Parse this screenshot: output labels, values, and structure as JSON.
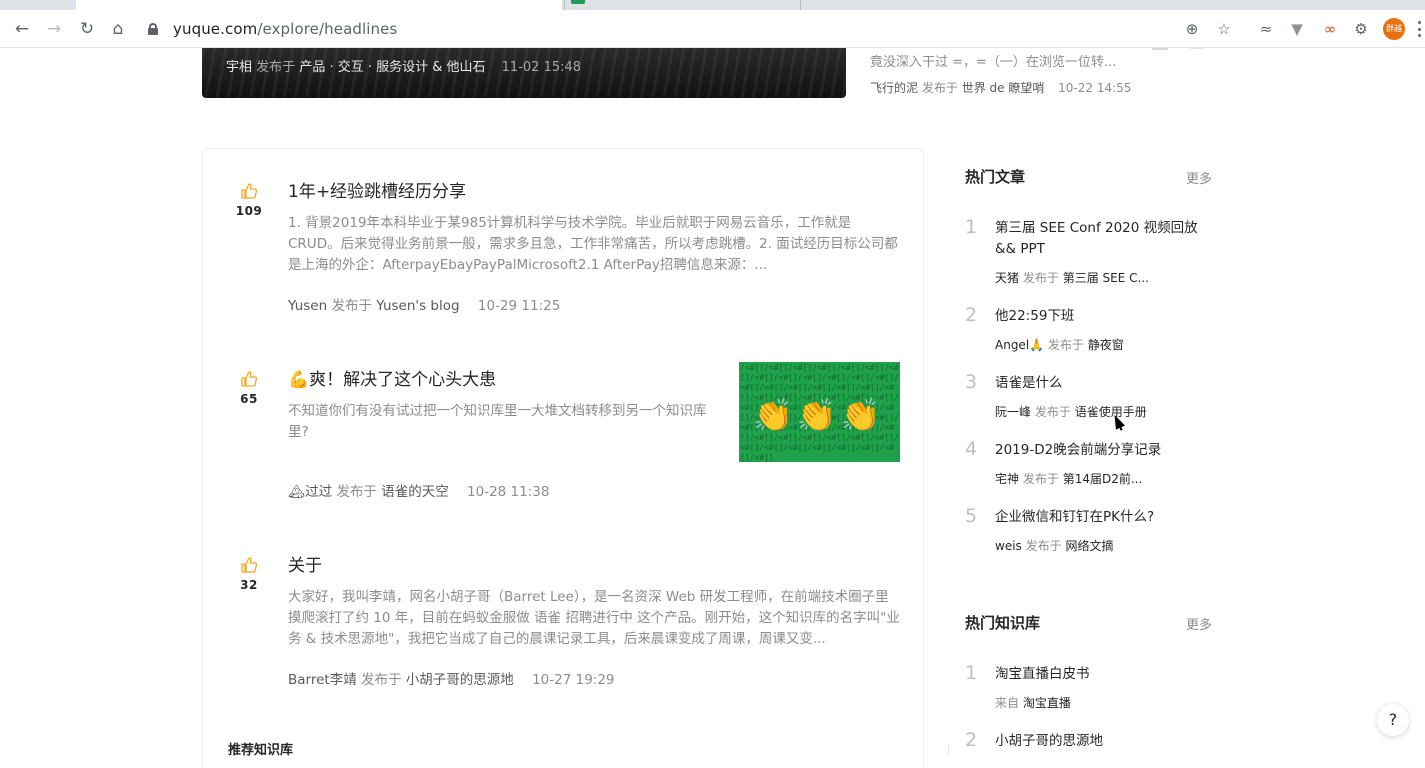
{
  "browser": {
    "url_host": "yuque.com",
    "url_path": "/explore/headlines",
    "extension_badge": "群越"
  },
  "hero": {
    "author": "宇相",
    "published_in": "发布于",
    "book": "产品 · 交互 · 服务设计 & 他山石",
    "time": "11-02 15:48"
  },
  "top_right": {
    "excerpt": "竟没深入干过 =，=（一）在浏览一位转...",
    "author": "飞行的泥",
    "published_in": "发布于",
    "book": "世界 de 瞭望哨",
    "time": "10-22 14:55"
  },
  "feed": {
    "posts": [
      {
        "likes": "109",
        "title": "1年+经验跳槽经历分享",
        "excerpt": "1. 背景2019年本科毕业于某985计算机科学与技术学院。毕业后就职于网易云音乐，工作就是CRUD。后来觉得业务前景一般，需求多且急，工作非常痛苦，所以考虑跳槽。2. 面试经历目标公司都是上海的外企：AfterpayEbayPayPalMicrosoft2.1 AfterPay招聘信息来源：...",
        "author": "Yusen",
        "published_in": "发布于",
        "book": "Yusen's blog",
        "time": "10-29 11:25"
      },
      {
        "likes": "65",
        "title": "💪爽！解决了这个心头大患",
        "excerpt": "不知道你们有没有试过把一个知识库里一大堆文档转移到另一个知识库里?",
        "author": "🏔过过",
        "published_in": "发布于",
        "book": "语雀的天空",
        "time": "10-28 11:38",
        "cover_emoji": "👏👏👏"
      },
      {
        "likes": "32",
        "title": "关于",
        "excerpt": "大家好，我叫李靖，网名小胡子哥（Barret Lee），是一名资深 Web 研发工程师，在前端技术圈子里摸爬滚打了约 10 年，目前在蚂蚁金服做 语雀 招聘进行中 这个产品。刚开始，这个知识库的名字叫\"业务 & 技术思源地\"，我把它当成了自己的晨课记录工具，后来晨课变成了周课，周课又变...",
        "author": "Barret李靖",
        "published_in": "发布于",
        "book": "小胡子哥的思源地",
        "time": "10-27 19:29"
      }
    ],
    "recommend_title": "推荐知识库"
  },
  "sidebar": {
    "hot_articles": {
      "title": "热门文章",
      "more": "更多",
      "items": [
        {
          "rank": "1",
          "title": "第三届 SEE Conf 2020 视频回放 && PPT",
          "author": "天猪",
          "published_in": "发布于",
          "book": "第三届 SEE C..."
        },
        {
          "rank": "2",
          "title": "他22:59下班",
          "author": "Angel🙏",
          "published_in": "发布于",
          "book": "静夜窗"
        },
        {
          "rank": "3",
          "title": "语雀是什么",
          "author": "阮一峰",
          "published_in": "发布于",
          "book": "语雀使用手册"
        },
        {
          "rank": "4",
          "title": "2019-D2晚会前端分享记录",
          "author": "宅神",
          "published_in": "发布于",
          "book": "第14届D2前..."
        },
        {
          "rank": "5",
          "title": "企业微信和钉钉在PK什么?",
          "author": "weis",
          "published_in": "发布于",
          "book": "网络文摘"
        }
      ]
    },
    "hot_books": {
      "title": "热门知识库",
      "more": "更多",
      "items": [
        {
          "rank": "1",
          "title": "淘宝直播白皮书",
          "from": "来自",
          "group": "淘宝直播"
        },
        {
          "rank": "2",
          "title": "小胡子哥的思源地"
        }
      ]
    }
  },
  "help": "?",
  "colors": {
    "accent_like": "#f5a623",
    "cover_green": "#1fa04a"
  }
}
